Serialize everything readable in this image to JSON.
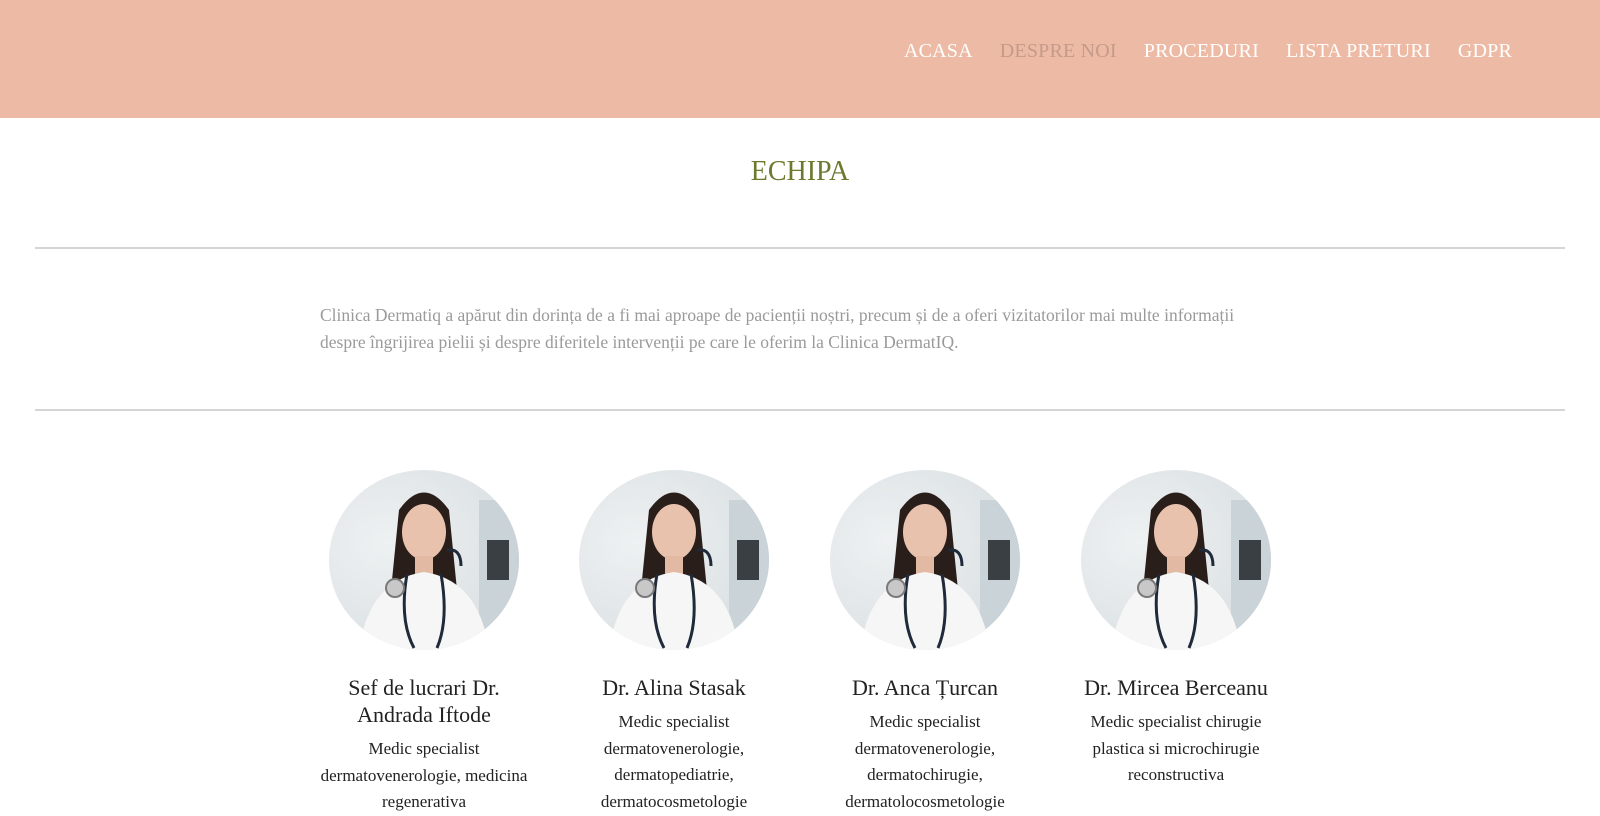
{
  "nav": {
    "items": [
      {
        "label": "ACASA"
      },
      {
        "label": "DESPRE NOI"
      },
      {
        "label": "PROCEDURI"
      },
      {
        "label": "LISTA PRETURI"
      },
      {
        "label": "GDPR"
      }
    ],
    "active_item": "DESPRE NOI"
  },
  "page": {
    "title": "ECHIPA",
    "intro": "Clinica Dermatiq a apărut din dorința de a fi mai aproape de pacienții noștri, precum și de a oferi vizitatorilor mai multe informații despre îngrijirea pielii și despre diferitele intervenții pe care le oferim la Clinica DermatIQ."
  },
  "team": [
    {
      "name": "Sef de lucrari Dr. Andrada Iftode",
      "role": "Medic specialist dermatovenerologie, medicina regenerativa"
    },
    {
      "name": "Dr. Alina Stasak",
      "role": "Medic specialist dermatovenerologie, dermatopediatrie, dermatocosmetologie"
    },
    {
      "name": "Dr. Anca Țurcan",
      "role": "Medic specialist dermatovenerologie, dermatochirugie, dermatolocosmetologie"
    },
    {
      "name": "Dr. Mircea Berceanu",
      "role": "Medic specialist chirugie plastica si microchirugie reconstructiva"
    }
  ],
  "colors": {
    "header_bg": "#edbba5",
    "title": "#6b7a2e",
    "nav_active": "#c59a8a",
    "intro_text": "#9a9a9a"
  }
}
